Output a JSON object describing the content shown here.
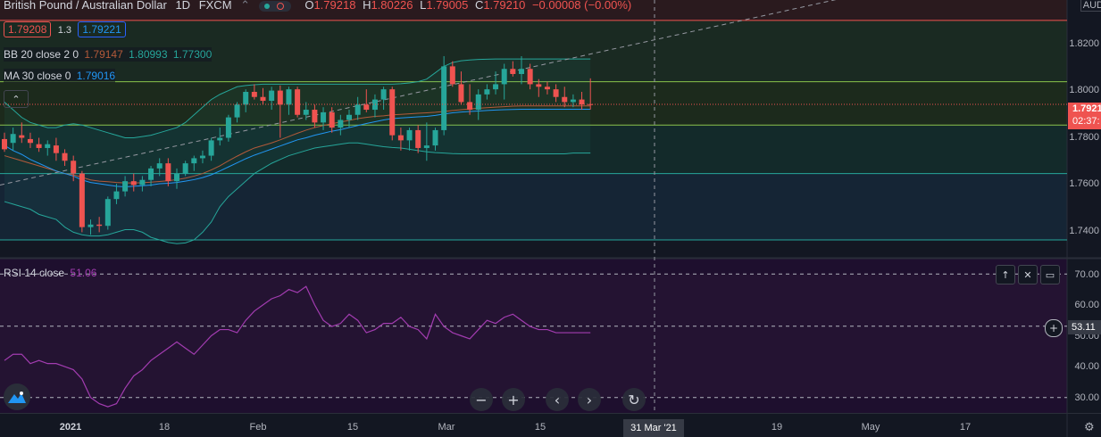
{
  "header": {
    "symbol": "British Pound / Australian Dollar",
    "interval": "1D",
    "exchange": "FXCM",
    "more": "⌃",
    "open_label": "O",
    "open": "1.79218",
    "high_label": "H",
    "high": "1.80226",
    "low_label": "L",
    "low": "1.79005",
    "close_label": "C",
    "close": "1.79210",
    "change": "−0.00008 (−0.00%)"
  },
  "trade": {
    "sell": "1.79208",
    "spread": "1.3",
    "buy": "1.79221"
  },
  "bb": {
    "label": "BB 20 close 2 0",
    "basis": "1.79147",
    "upper": "1.80993",
    "lower": "1.77300"
  },
  "ma": {
    "label": "MA 30 close 0",
    "value": "1.79016"
  },
  "rsi": {
    "label": "RSI 14 close",
    "value": "51.06"
  },
  "price_axis": {
    "currency": "AUD",
    "ticks": [
      "1.8200",
      "1.8000",
      "1.7800",
      "1.7600",
      "1.7400"
    ],
    "current_price": "1.7921",
    "countdown": "02:37:"
  },
  "rsi_axis": {
    "ticks": [
      "70.00",
      "60.00",
      "50.00",
      "40.00",
      "30.00"
    ],
    "current": "53.11"
  },
  "time_axis": {
    "labels": [
      "2021",
      "18",
      "Feb",
      "15",
      "Mar",
      "15",
      "19",
      "May",
      "17"
    ],
    "crosshair": "31 Mar '21"
  },
  "colors": {
    "background": "#131722",
    "up": "#26a69a",
    "down": "#ef5350",
    "ma": "#2196f3",
    "bb_basis": "#b35a3a",
    "bb_band": "#26a69a",
    "rsi": "#a23cb0",
    "rsi_bg": "#1e0f2e"
  },
  "icons": {
    "zoom_out": "−",
    "zoom_in": "+",
    "scroll_left": "‹",
    "scroll_right": "›",
    "reset": "↻",
    "collapse": "⌃",
    "move_up": "↑",
    "close": "✕",
    "maximize": "▭",
    "add": "+",
    "settings": "⚙"
  },
  "chart_data": {
    "type": "candlestick",
    "candles": [
      [
        1.7785,
        1.781,
        1.7735,
        1.7745
      ],
      [
        1.777,
        1.783,
        1.774,
        1.7805
      ],
      [
        1.78,
        1.785,
        1.777,
        1.779
      ],
      [
        1.7785,
        1.781,
        1.775,
        1.777
      ],
      [
        1.7765,
        1.779,
        1.7735,
        1.775
      ],
      [
        1.775,
        1.778,
        1.772,
        1.7765
      ],
      [
        1.776,
        1.779,
        1.77,
        1.773
      ],
      [
        1.773,
        1.7745,
        1.768,
        1.77
      ],
      [
        1.77,
        1.772,
        1.762,
        1.765
      ],
      [
        1.765,
        1.766,
        1.742,
        1.744
      ],
      [
        1.744,
        1.747,
        1.741,
        1.745
      ],
      [
        1.745,
        1.748,
        1.742,
        1.7445
      ],
      [
        1.7445,
        1.756,
        1.743,
        1.755
      ],
      [
        1.755,
        1.761,
        1.753,
        1.758
      ],
      [
        1.758,
        1.764,
        1.756,
        1.762
      ],
      [
        1.762,
        1.765,
        1.758,
        1.7605
      ],
      [
        1.7605,
        1.764,
        1.758,
        1.7625
      ],
      [
        1.7625,
        1.768,
        1.76,
        1.767
      ],
      [
        1.767,
        1.771,
        1.764,
        1.769
      ],
      [
        1.769,
        1.771,
        1.76,
        1.762
      ],
      [
        1.762,
        1.767,
        1.759,
        1.765
      ],
      [
        1.765,
        1.77,
        1.764,
        1.769
      ],
      [
        1.769,
        1.772,
        1.766,
        1.771
      ],
      [
        1.771,
        1.774,
        1.769,
        1.772
      ],
      [
        1.772,
        1.779,
        1.77,
        1.778
      ],
      [
        1.778,
        1.783,
        1.776,
        1.779
      ],
      [
        1.779,
        1.788,
        1.7775,
        1.787
      ],
      [
        1.787,
        1.793,
        1.785,
        1.792
      ],
      [
        1.792,
        1.798,
        1.789,
        1.797
      ],
      [
        1.797,
        1.8,
        1.794,
        1.795
      ],
      [
        1.795,
        1.7985,
        1.792,
        1.7935
      ],
      [
        1.7935,
        1.799,
        1.79,
        1.7975
      ],
      [
        1.7975,
        1.7995,
        1.779,
        1.792
      ],
      [
        1.792,
        1.799,
        1.788,
        1.798
      ],
      [
        1.798,
        1.799,
        1.787,
        1.788
      ],
      [
        1.788,
        1.793,
        1.786,
        1.79
      ],
      [
        1.79,
        1.792,
        1.783,
        1.785
      ],
      [
        1.785,
        1.791,
        1.782,
        1.789
      ],
      [
        1.789,
        1.791,
        1.781,
        1.783
      ],
      [
        1.783,
        1.788,
        1.78,
        1.786
      ],
      [
        1.786,
        1.79,
        1.783,
        1.788
      ],
      [
        1.788,
        1.795,
        1.786,
        1.792
      ],
      [
        1.792,
        1.798,
        1.789,
        1.79
      ],
      [
        1.79,
        1.796,
        1.787,
        1.794
      ],
      [
        1.794,
        1.799,
        1.79,
        1.798
      ],
      [
        1.798,
        1.799,
        1.778,
        1.78
      ],
      [
        1.78,
        1.783,
        1.774,
        1.778
      ],
      [
        1.778,
        1.783,
        1.774,
        1.782
      ],
      [
        1.782,
        1.784,
        1.773,
        1.775
      ],
      [
        1.775,
        1.785,
        1.77,
        1.776
      ],
      [
        1.776,
        1.783,
        1.774,
        1.782
      ],
      [
        1.782,
        1.811,
        1.78,
        1.807
      ],
      [
        1.807,
        1.809,
        1.799,
        1.8
      ],
      [
        1.8,
        1.805,
        1.792,
        1.793
      ],
      [
        1.793,
        1.8,
        1.788,
        1.79
      ],
      [
        1.79,
        1.798,
        1.786,
        1.796
      ],
      [
        1.796,
        1.8,
        1.794,
        1.798
      ],
      [
        1.798,
        1.805,
        1.796,
        1.8
      ],
      [
        1.8,
        1.808,
        1.794,
        1.806
      ],
      [
        1.806,
        1.809,
        1.803,
        1.804
      ],
      [
        1.804,
        1.811,
        1.8,
        1.806
      ],
      [
        1.806,
        1.808,
        1.798,
        1.8
      ],
      [
        1.8,
        1.802,
        1.795,
        1.799
      ],
      [
        1.799,
        1.801,
        1.796,
        1.798
      ],
      [
        1.798,
        1.8,
        1.793,
        1.795
      ],
      [
        1.795,
        1.799,
        1.791,
        1.793
      ],
      [
        1.793,
        1.796,
        1.791,
        1.794
      ],
      [
        1.794,
        1.797,
        1.79,
        1.792
      ],
      [
        1.7922,
        1.8023,
        1.7901,
        1.7921
      ]
    ],
    "price_range": [
      1.732,
      1.833
    ],
    "horizontal_lines": [
      1.825,
      1.801,
      1.784,
      1.765,
      1.739
    ],
    "rsi_range": [
      25,
      75
    ],
    "rsi_levels": [
      70,
      53.11,
      30
    ],
    "rsi": [
      42,
      44,
      44,
      41,
      42,
      41,
      41,
      40,
      39,
      36,
      30,
      28,
      27,
      28,
      33,
      37,
      39,
      42,
      44,
      46,
      48,
      46,
      44,
      47,
      50,
      52,
      52,
      51,
      55,
      58,
      60,
      62,
      63,
      65,
      64,
      66,
      60,
      55,
      53,
      54,
      57,
      55,
      51,
      52,
      54,
      54,
      56,
      53,
      52,
      49,
      57,
      53,
      51,
      50,
      49,
      52,
      55,
      54,
      56,
      57,
      55,
      53,
      52,
      52,
      51,
      51,
      51,
      51,
      51
    ],
    "ma": [
      1.776,
      1.774,
      1.7725,
      1.7705,
      1.769,
      1.7675,
      1.766,
      1.765,
      1.764,
      1.7625,
      1.7615,
      1.761,
      1.7605,
      1.76,
      1.7598,
      1.76,
      1.7602,
      1.7605,
      1.761,
      1.7612,
      1.7615,
      1.762,
      1.7626,
      1.7634,
      1.7645,
      1.766,
      1.7676,
      1.7692,
      1.7708,
      1.7722,
      1.7734,
      1.7746,
      1.7758,
      1.777,
      1.7782,
      1.779,
      1.78,
      1.7808,
      1.7816,
      1.7822,
      1.783,
      1.7838,
      1.7846,
      1.7853,
      1.786,
      1.7865,
      1.7868,
      1.787,
      1.7872,
      1.7874,
      1.7878,
      1.7883,
      1.7888,
      1.7891,
      1.7893,
      1.7895,
      1.7897,
      1.7899,
      1.79,
      1.7901,
      1.7902,
      1.7902,
      1.7902,
      1.7902,
      1.7902,
      1.7902,
      1.7902,
      1.7902,
      1.7902
    ],
    "bb_basis": [
      1.772,
      1.771,
      1.77,
      1.769,
      1.768,
      1.767,
      1.766,
      1.765,
      1.7645,
      1.7635,
      1.7625,
      1.762,
      1.7618,
      1.7615,
      1.7613,
      1.7613,
      1.7614,
      1.7616,
      1.7619,
      1.7622,
      1.7626,
      1.7632,
      1.764,
      1.765,
      1.7664,
      1.768,
      1.77,
      1.7718,
      1.7735,
      1.775,
      1.776,
      1.777,
      1.7782,
      1.7795,
      1.7808,
      1.782,
      1.783,
      1.7838,
      1.7845,
      1.7852,
      1.7858,
      1.7865,
      1.787,
      1.7874,
      1.7876,
      1.788,
      1.7882,
      1.7884,
      1.7886,
      1.7888,
      1.789,
      1.7893,
      1.7897,
      1.79,
      1.7903,
      1.7906,
      1.7908,
      1.791,
      1.7912,
      1.7914,
      1.7915,
      1.7915,
      1.7915,
      1.7915,
      1.7915,
      1.7915,
      1.7915,
      1.7915,
      1.7915
    ],
    "bb_upper": [
      1.793,
      1.79,
      1.787,
      1.785,
      1.784,
      1.783,
      1.783,
      1.784,
      1.7845,
      1.784,
      1.783,
      1.782,
      1.781,
      1.78,
      1.779,
      1.779,
      1.7795,
      1.78,
      1.781,
      1.782,
      1.783,
      1.785,
      1.788,
      1.791,
      1.794,
      1.796,
      1.7975,
      1.799,
      1.7995,
      1.7998,
      1.8,
      1.8,
      1.8,
      1.8,
      1.8,
      1.8,
      1.8,
      1.8,
      1.8,
      1.8,
      1.8,
      1.8,
      1.8,
      1.8,
      1.8,
      1.8,
      1.8002,
      1.8005,
      1.801,
      1.802,
      1.8045,
      1.807,
      1.8085,
      1.8092,
      1.8095,
      1.8097,
      1.8098,
      1.8099,
      1.8099,
      1.8099,
      1.8099,
      1.8099,
      1.8099,
      1.8099,
      1.8099,
      1.8099,
      1.8099,
      1.8099,
      1.8099
    ],
    "bb_lower": [
      1.754,
      1.753,
      1.752,
      1.751,
      1.749,
      1.748,
      1.747,
      1.744,
      1.742,
      1.741,
      1.7405,
      1.7405,
      1.741,
      1.742,
      1.743,
      1.743,
      1.742,
      1.74,
      1.739,
      1.738,
      1.7375,
      1.7378,
      1.739,
      1.742,
      1.746,
      1.752,
      1.756,
      1.759,
      1.762,
      1.765,
      1.767,
      1.769,
      1.7705,
      1.772,
      1.773,
      1.774,
      1.775,
      1.7755,
      1.776,
      1.7765,
      1.777,
      1.777,
      1.7765,
      1.776,
      1.7755,
      1.7752,
      1.775,
      1.7745,
      1.774,
      1.7735,
      1.7732,
      1.773,
      1.7728,
      1.7727,
      1.7727,
      1.7727,
      1.7727,
      1.7727,
      1.7727,
      1.7727,
      1.7727,
      1.7727,
      1.7727,
      1.7727,
      1.7727,
      1.7727,
      1.773,
      1.773,
      1.773
    ]
  }
}
